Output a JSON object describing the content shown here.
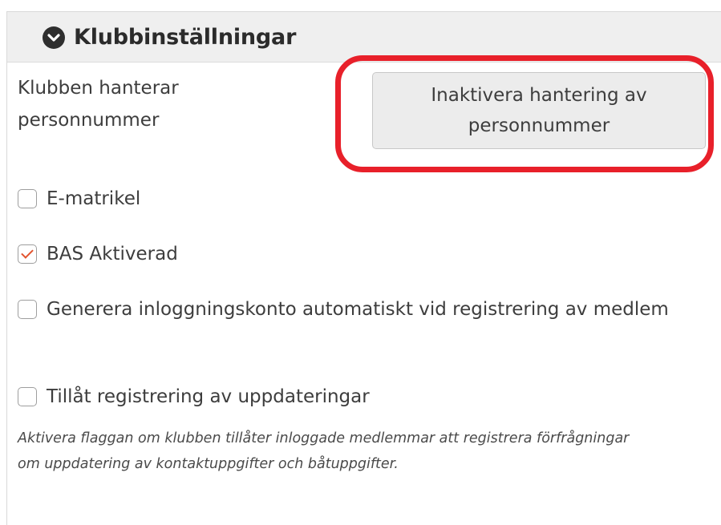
{
  "panel": {
    "title": "Klubbinställningar",
    "toggle_icon": "chevron-down-circle-icon"
  },
  "personnummer": {
    "label": "Klubben hanterar personnummer",
    "button_label": "Inaktivera hantering av personnummer"
  },
  "options": [
    {
      "label": "E-matrikel",
      "checked": false
    },
    {
      "label": "BAS Aktiverad",
      "checked": true
    },
    {
      "label": "Generera inloggningskonto automatiskt vid registrering av medlem",
      "checked": false
    },
    {
      "label": "Tillåt registrering av uppdateringar",
      "checked": false
    }
  ],
  "help_text": "Aktivera flaggan om klubben tillåter inloggade medlemmar att registrera förfrågningar om uppdatering av kontaktuppgifter och båtuppgifter.",
  "colors": {
    "accent_check": "#e2542f",
    "highlight_ring": "#e8202a",
    "header_bg": "#efefef"
  }
}
